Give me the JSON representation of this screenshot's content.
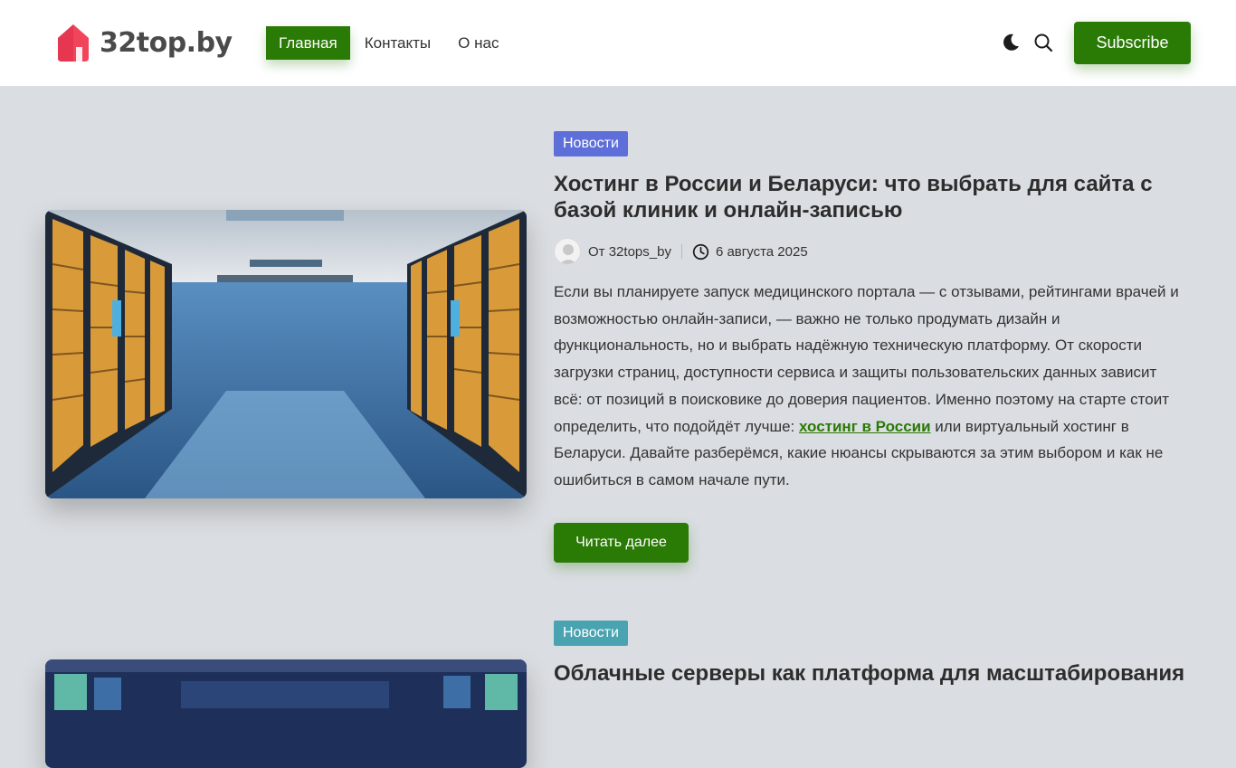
{
  "site": {
    "logo_text": "32top.by",
    "brand_color": "#2a7a06",
    "logo_color": "#f0455a"
  },
  "nav": {
    "items": [
      {
        "label": "Главная",
        "active": true
      },
      {
        "label": "Контакты",
        "active": false
      },
      {
        "label": "О нас",
        "active": false
      }
    ]
  },
  "header_actions": {
    "theme_icon": "moon-icon",
    "search_icon": "search-icon",
    "subscribe_label": "Subscribe"
  },
  "posts": [
    {
      "category": "Новости",
      "category_color": "#5f6fd9",
      "title": "Хостинг в России и Беларуси: что выбрать для сайта с базой клиник и онлайн-записью",
      "author_prefix": "От",
      "author": "32tops_by",
      "date": "6 августа 2025",
      "excerpt_before": "Если вы планируете запуск медицинского портала — с отзывами, рейтингами врачей и возможностью онлайн-записи, — важно не только продумать дизайн и функциональность, но и выбрать надёжную техническую платформу. От скорости загрузки страниц, доступности сервиса и защиты пользовательских данных зависит всё: от позиций в поисковике до доверия пациентов. Именно поэтому на старте стоит определить, что подойдёт лучше: ",
      "excerpt_link": "хостинг в России",
      "excerpt_after": " или виртуальный хостинг в Беларуси. Давайте разберёмся, какие нюансы скрываются за этим выбором и как не ошибиться в самом начале пути.",
      "read_more": "Читать далее"
    },
    {
      "category": "Новости",
      "category_color": "#4aa3b0",
      "title": "Облачные серверы как платформа для масштабирования"
    }
  ]
}
